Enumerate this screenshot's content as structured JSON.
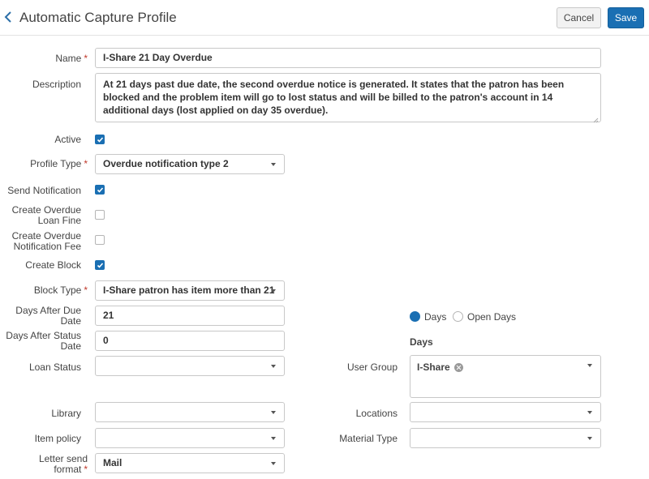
{
  "header": {
    "title": "Automatic Capture Profile",
    "cancel_label": "Cancel",
    "save_label": "Save",
    "back_icon": "chevron-left-icon"
  },
  "form": {
    "name": {
      "label": "Name",
      "required": "*",
      "value": "I-Share 21 Day Overdue"
    },
    "description": {
      "label": "Description",
      "value": "At 21 days past due date, the second overdue notice is generated. It states that the patron has been blocked and the problem item will go to lost status and will be billed to the patron's account in 14 additional days (lost applied on day 35 overdue)."
    },
    "active": {
      "label": "Active",
      "checked": true
    },
    "profile_type": {
      "label": "Profile Type",
      "required": "*",
      "value": "Overdue notification type 2"
    },
    "send_notification": {
      "label": "Send Notification",
      "checked": true
    },
    "create_overdue_loan_fine": {
      "label_line1": "Create Overdue",
      "label_line2": "Loan Fine",
      "checked": false
    },
    "create_overdue_notification_fee": {
      "label_line1": "Create Overdue",
      "label_line2": "Notification Fee",
      "checked": false
    },
    "create_block": {
      "label": "Create Block",
      "checked": true
    },
    "block_type": {
      "label": "Block Type",
      "required": "*",
      "value": "I-Share patron has item more than 21"
    },
    "days_after_due_date": {
      "label_line1": "Days After Due",
      "label_line2": "Date",
      "value": "21"
    },
    "days_after_status_date": {
      "label_line1": "Days After Status",
      "label_line2": "Date",
      "value": "0"
    },
    "days_mode": {
      "options": [
        {
          "label": "Days",
          "selected": true
        },
        {
          "label": "Open Days",
          "selected": false
        }
      ],
      "section_label": "Days"
    },
    "loan_status": {
      "label": "Loan Status",
      "value": ""
    },
    "user_group": {
      "label": "User Group",
      "chips": [
        "I-Share"
      ]
    },
    "library": {
      "label": "Library",
      "value": ""
    },
    "locations": {
      "label": "Locations",
      "value": ""
    },
    "item_policy": {
      "label": "Item policy",
      "value": ""
    },
    "material_type": {
      "label": "Material Type",
      "value": ""
    },
    "letter_send_format": {
      "label_line1": "Letter send",
      "label_line2": "format",
      "required": "*",
      "value": "Mail"
    }
  },
  "colors": {
    "accent": "#1a6fb3",
    "required": "#c0392b"
  }
}
